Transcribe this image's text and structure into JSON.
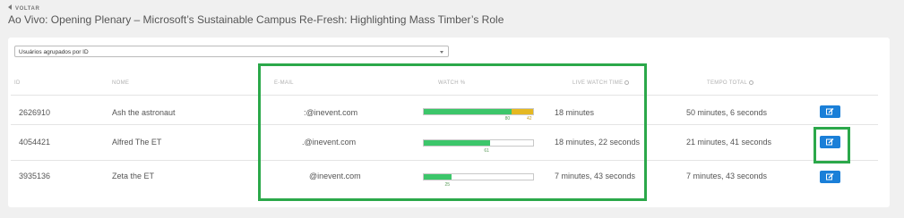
{
  "header": {
    "back_label": "VOLTAR",
    "title": "Ao Vivo: Opening Plenary – Microsoft’s Sustainable Campus Re-Fresh: Highlighting Mass Timber’s Role"
  },
  "filter": {
    "selected": "Usuários agrupados por ID"
  },
  "table": {
    "columns": {
      "id": "ID",
      "name": "NOME",
      "email": "E-MAIL",
      "watch": "WATCH %",
      "live_watch_time": "LIVE WATCH TIME",
      "total_time": "TEMPO TOTAL"
    },
    "rows": [
      {
        "id": "2626910",
        "name": "Ash the astronaut",
        "email": ":@inevent.com",
        "watch_primary": 80,
        "watch_secondary": 42,
        "live_watch_time": "18 minutes",
        "total_time": "50 minutes, 6 seconds"
      },
      {
        "id": "4054421",
        "name": "Alfred The ET",
        "email": ".@inevent.com",
        "watch_primary": 61,
        "live_watch_time": "18 minutes, 22 seconds",
        "total_time": "21 minutes, 41 seconds"
      },
      {
        "id": "3935136",
        "name": "Zeta the ET",
        "email": "@inevent.com",
        "watch_primary": 25,
        "live_watch_time": "7 minutes, 43 seconds",
        "total_time": "7 minutes, 43 seconds"
      }
    ]
  },
  "colors": {
    "watch_bar": "#3cc66a",
    "watch_bar_secondary": "#e5b821",
    "edit_button": "#1a7fd8",
    "highlight": "#2ba84a"
  },
  "icons": {
    "back": "caret-left-icon",
    "edit": "edit-icon",
    "info": "info-icon",
    "dropdown": "chevron-down-icon"
  }
}
